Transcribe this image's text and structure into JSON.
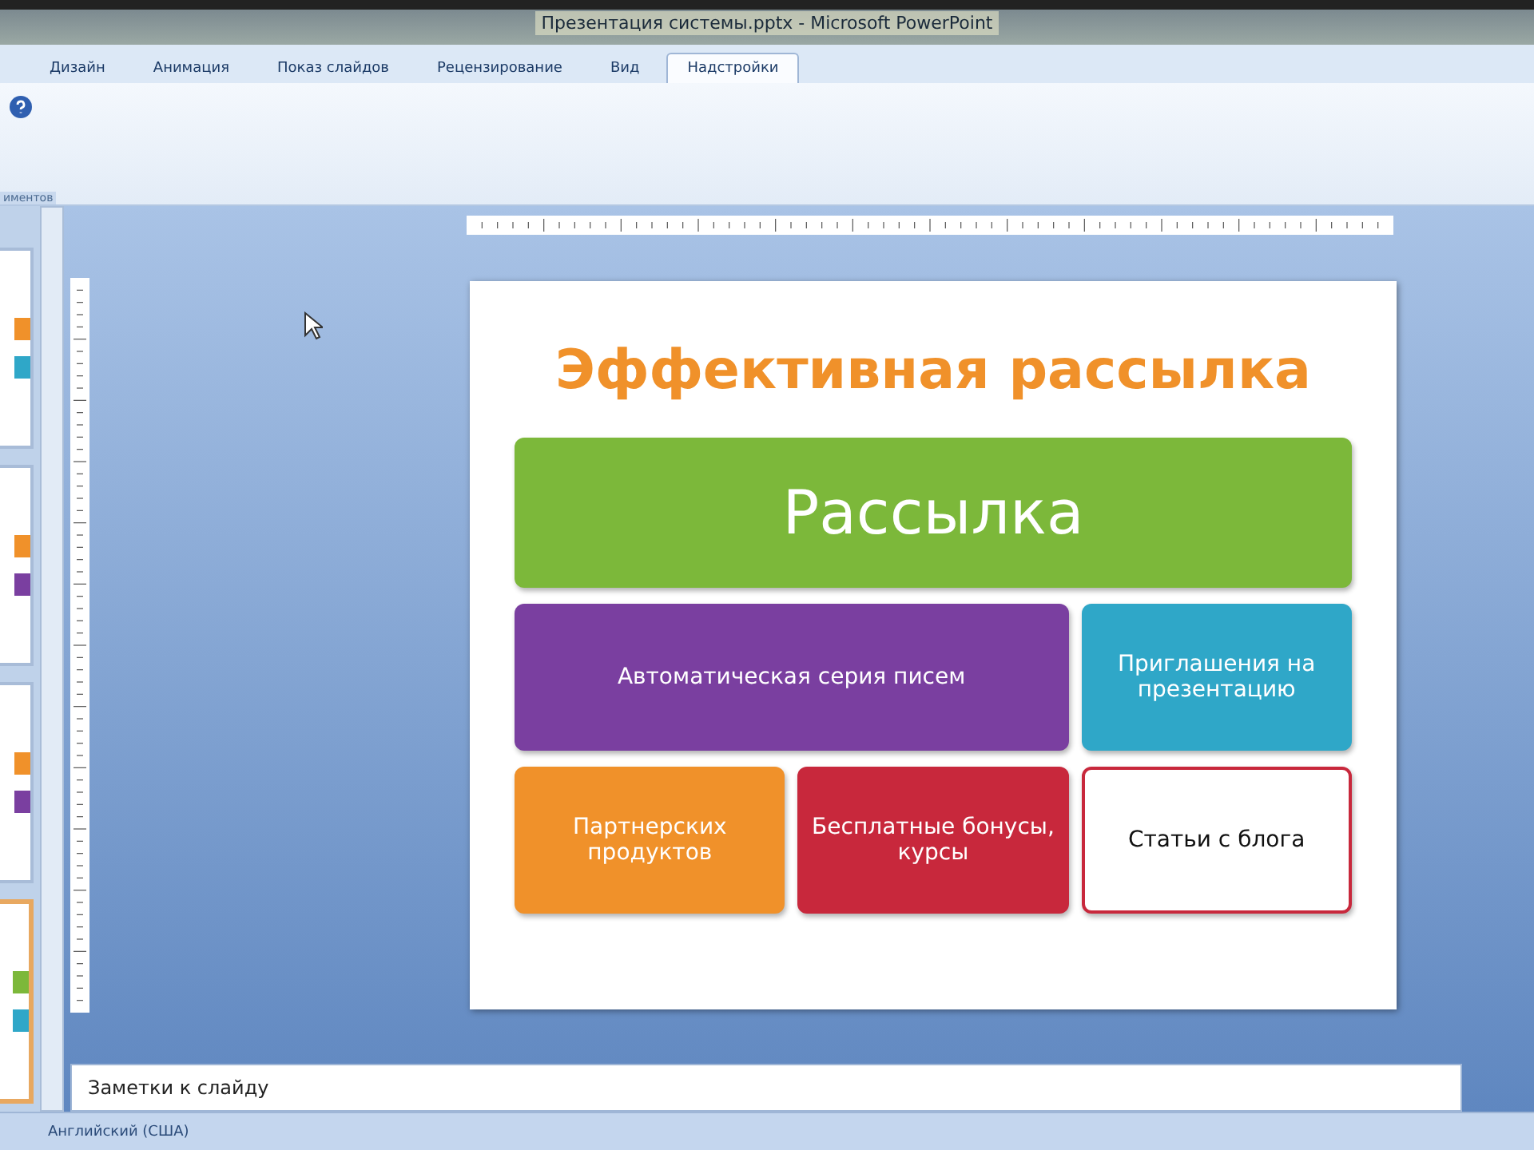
{
  "window": {
    "title": "Презентация системы.pptx - Microsoft PowerPoint"
  },
  "ribbon_tabs": [
    {
      "label": "Дизайн",
      "selected": false
    },
    {
      "label": "Анимация",
      "selected": false
    },
    {
      "label": "Показ слайдов",
      "selected": false
    },
    {
      "label": "Рецензирование",
      "selected": false
    },
    {
      "label": "Вид",
      "selected": false
    },
    {
      "label": "Надстройки",
      "selected": true
    }
  ],
  "ribbon_group_label": "иментов",
  "thumbnails": [
    {
      "selected": false
    },
    {
      "selected": false
    },
    {
      "selected": false
    },
    {
      "selected": true
    }
  ],
  "slide": {
    "title": "Эффективная рассылка",
    "blocks": [
      {
        "text": "Рассылка",
        "kind": "filled",
        "color": "#7cb83a"
      },
      {
        "text": "Автоматическая серия писем",
        "kind": "filled",
        "color": "#7a3fa0"
      },
      {
        "text": "Приглашения на презентацию",
        "kind": "filled",
        "color": "#2fa7c8"
      },
      {
        "text": "Партнерских продуктов",
        "kind": "filled",
        "color": "#f0912a"
      },
      {
        "text": "Бесплатные бонусы, курсы",
        "kind": "filled",
        "color": "#c8283c"
      },
      {
        "text": "Статьи с блога",
        "kind": "outline",
        "color": "#c8283c"
      }
    ]
  },
  "notes": {
    "placeholder": "Заметки к слайду"
  },
  "status_bar": {
    "language": "Английский (США)"
  }
}
